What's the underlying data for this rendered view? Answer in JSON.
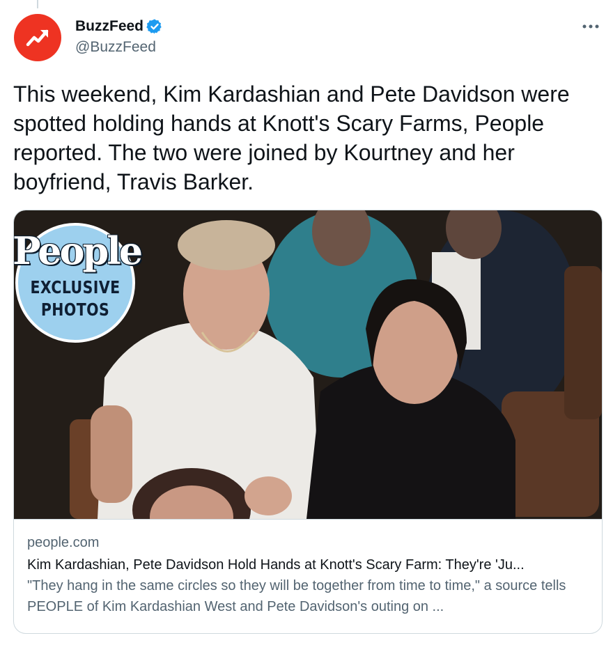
{
  "tweet": {
    "author": {
      "display_name": "BuzzFeed",
      "handle": "@BuzzFeed",
      "verified": true,
      "avatar_icon": "trending-arrow-icon",
      "brand_color": "#ee3322"
    },
    "text": "This weekend, Kim Kardashian and Pete Davidson were spotted holding hands at Knott's Scary Farms, People reported. The two were joined by Kourtney and her boyfriend, Travis Barker.",
    "more_icon": "more-dots-icon",
    "card": {
      "image_badge": {
        "brand": "People",
        "line1": "EXCLUSIVE",
        "line2": "PHOTOS"
      },
      "domain": "people.com",
      "title": "Kim Kardashian, Pete Davidson Hold Hands at Knott's Scary Farm: They're 'Ju...",
      "description": "\"They hang in the same circles so they will be together from time to time,\" a source tells PEOPLE of Kim Kardashian West and Pete Davidson's outing on ..."
    }
  },
  "colors": {
    "verified_blue": "#1d9bf0",
    "secondary_text": "#536471",
    "border": "#cfd9de"
  }
}
